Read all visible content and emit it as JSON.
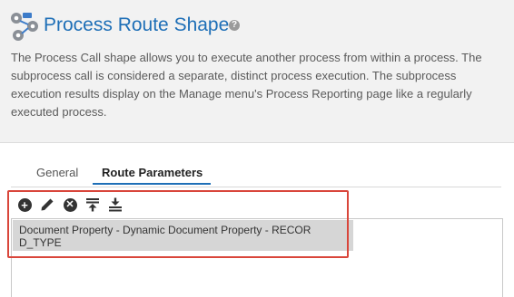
{
  "header": {
    "title": "Process Route Shape",
    "help_icon": "question-circle-icon",
    "description": "The Process Call shape allows you to execute another process from within a process. The subprocess call is considered a separate, distinct process execution. The subprocess execution results display on the Manage menu's Process Reporting page like a regularly executed process."
  },
  "tabs": [
    {
      "label": "General",
      "active": false
    },
    {
      "label": "Route Parameters",
      "active": true
    }
  ],
  "toolbar": {
    "buttons": [
      "add-icon",
      "edit-pencil-icon",
      "remove-icon",
      "move-to-top-icon",
      "move-to-bottom-icon"
    ]
  },
  "parameters": {
    "items": [
      {
        "label": "Document Property - Dynamic Document Property - RECORD_TYPE",
        "selected": true
      }
    ]
  },
  "colors": {
    "title": "#1e6fb7",
    "header_bg": "#f2f2f2",
    "tab_underline": "#1e6fb7",
    "highlight_border": "#d9463b",
    "selected_row": "#d6d6d6"
  }
}
